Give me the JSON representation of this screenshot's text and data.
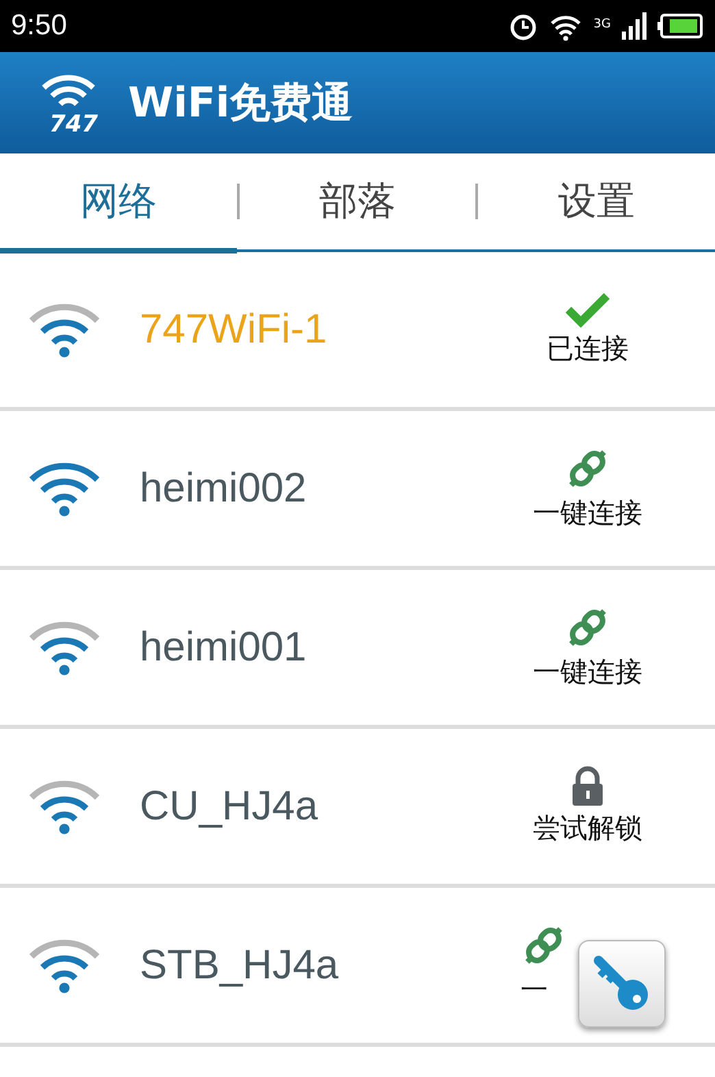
{
  "status_bar": {
    "time": "9:50",
    "network": "3G"
  },
  "app_bar": {
    "title": "WiFi免费通",
    "logo_text": "747"
  },
  "tabs": [
    {
      "label": "网络",
      "selected": true
    },
    {
      "label": "部落",
      "selected": false
    },
    {
      "label": "设置",
      "selected": false
    }
  ],
  "networks": [
    {
      "name": "747WiFi-1",
      "connected": true,
      "full_signal": false,
      "action": {
        "kind": "connected",
        "label": "已连接"
      }
    },
    {
      "name": "heimi002",
      "connected": false,
      "full_signal": true,
      "action": {
        "kind": "connect",
        "label": "一键连接"
      }
    },
    {
      "name": "heimi001",
      "connected": false,
      "full_signal": false,
      "action": {
        "kind": "connect",
        "label": "一键连接"
      }
    },
    {
      "name": "CU_HJ4a",
      "connected": false,
      "full_signal": false,
      "action": {
        "kind": "unlock",
        "label": "尝试解锁"
      }
    },
    {
      "name": "STB_HJ4a",
      "connected": false,
      "full_signal": false,
      "action": {
        "kind": "connect",
        "label": "一"
      }
    }
  ]
}
